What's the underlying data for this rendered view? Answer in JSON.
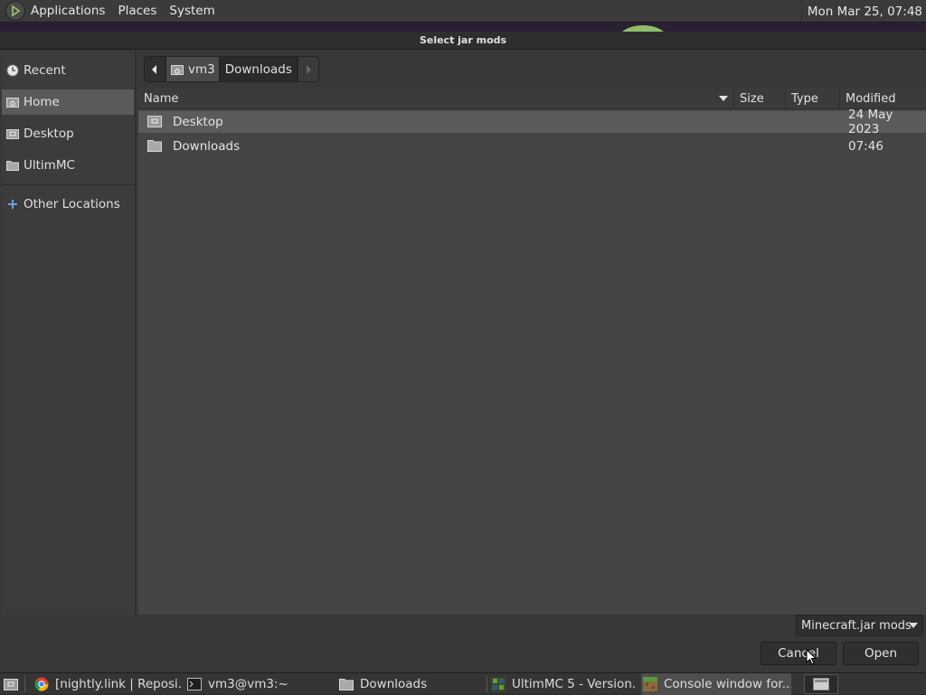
{
  "top_panel": {
    "menus": [
      "Applications",
      "Places",
      "System"
    ],
    "clock": "Mon Mar 25, 07:48"
  },
  "dialog": {
    "title": "Select jar mods",
    "sidebar": {
      "items": [
        {
          "label": "Recent",
          "icon": "recent-icon"
        },
        {
          "label": "Home",
          "icon": "home-folder-icon",
          "active": true
        },
        {
          "label": "Desktop",
          "icon": "desktop-folder-icon"
        },
        {
          "label": "UltimMC",
          "icon": "folder-icon"
        },
        {
          "label": "Other Locations",
          "icon": "plus-icon"
        }
      ]
    },
    "path": {
      "segments": [
        "vm3",
        "Downloads"
      ]
    },
    "columns": {
      "name": "Name",
      "size": "Size",
      "type": "Type",
      "modified": "Modified"
    },
    "files": [
      {
        "name": "Desktop",
        "modified": "24 May 2023",
        "icon": "desktop-folder-icon",
        "selected": true
      },
      {
        "name": "Downloads",
        "modified": "07:46",
        "icon": "folder-icon",
        "selected": false
      }
    ],
    "filter": "Minecraft.jar mods",
    "buttons": {
      "cancel": "Cancel",
      "open": "Open"
    }
  },
  "taskbar": {
    "items": [
      {
        "label": "[nightly.link | Reposi...",
        "icon": "chrome-icon"
      },
      {
        "label": "vm3@vm3:~",
        "icon": "terminal-icon"
      },
      {
        "label": "Downloads",
        "icon": "folder-icon"
      },
      {
        "label": "UltimMC 5 - Version...",
        "icon": "ultimmc-icon"
      },
      {
        "label": "Console window for...",
        "icon": "minecraft-icon",
        "active": true
      }
    ]
  },
  "colors": {
    "panel_bg": "#3b3b3b",
    "dialog_bg": "#383838",
    "selection": "#5b5b5b",
    "accent_blue": "#6aa0e0"
  }
}
